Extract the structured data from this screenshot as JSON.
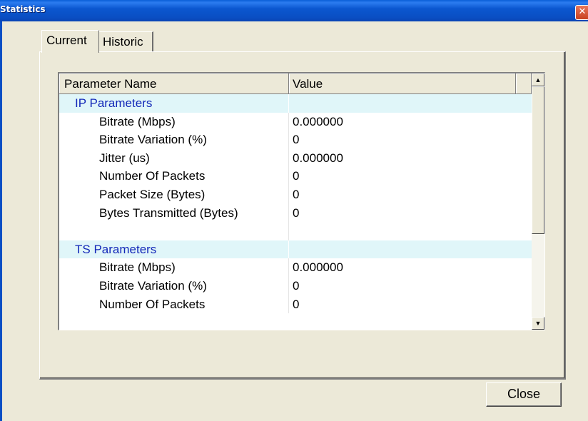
{
  "window": {
    "title": "Statistics",
    "close_glyph": "✕"
  },
  "tabs": [
    {
      "label": "Current",
      "selected": true
    },
    {
      "label": "Historic",
      "selected": false
    }
  ],
  "table": {
    "columns": [
      "Parameter Name",
      "Value"
    ],
    "rows": [
      {
        "kind": "group",
        "name": "IP Parameters",
        "value": ""
      },
      {
        "kind": "param",
        "name": "Bitrate (Mbps)",
        "value": "0.000000"
      },
      {
        "kind": "param",
        "name": "Bitrate Variation (%)",
        "value": "0"
      },
      {
        "kind": "param",
        "name": "Jitter (us)",
        "value": "0.000000"
      },
      {
        "kind": "param",
        "name": "Number Of Packets",
        "value": "0"
      },
      {
        "kind": "param",
        "name": "Packet Size (Bytes)",
        "value": "0"
      },
      {
        "kind": "param",
        "name": "Bytes Transmitted (Bytes)",
        "value": "0"
      },
      {
        "kind": "blank",
        "name": "",
        "value": ""
      },
      {
        "kind": "group",
        "name": "TS Parameters",
        "value": ""
      },
      {
        "kind": "param",
        "name": "Bitrate (Mbps)",
        "value": "0.000000"
      },
      {
        "kind": "param",
        "name": "Bitrate Variation (%)",
        "value": "0"
      },
      {
        "kind": "param",
        "name": "Number Of Packets",
        "value": "0"
      }
    ]
  },
  "scrollbar": {
    "up_glyph": "▲",
    "down_glyph": "▼"
  },
  "buttons": {
    "close_label": "Close"
  },
  "colors": {
    "title_bar": "#0a4fc4",
    "group_row_bg": "#e0f6f9",
    "group_text": "#1227b8",
    "dialog_bg": "#ece9d8"
  }
}
